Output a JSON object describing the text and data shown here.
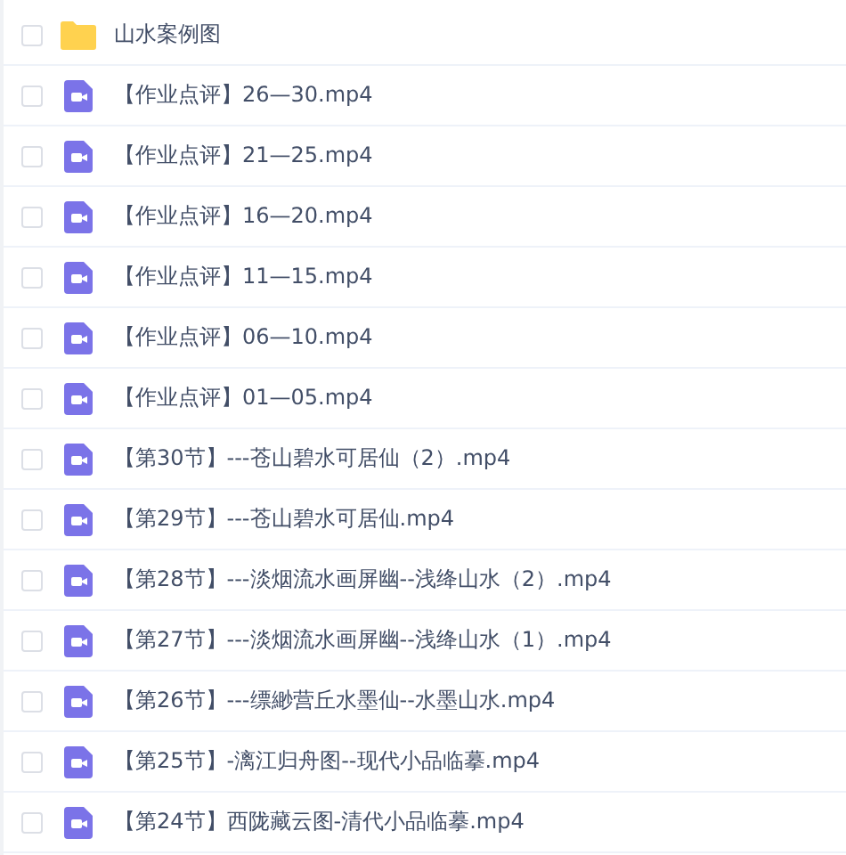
{
  "files": [
    {
      "kind": "folder",
      "name": "山水案例图",
      "checked": false
    },
    {
      "kind": "video",
      "name": "【作业点评】26—30.mp4",
      "checked": false
    },
    {
      "kind": "video",
      "name": "【作业点评】21—25.mp4",
      "checked": false
    },
    {
      "kind": "video",
      "name": "【作业点评】16—20.mp4",
      "checked": false
    },
    {
      "kind": "video",
      "name": "【作业点评】11—15.mp4",
      "checked": false
    },
    {
      "kind": "video",
      "name": "【作业点评】06—10.mp4",
      "checked": false
    },
    {
      "kind": "video",
      "name": "【作业点评】01—05.mp4",
      "checked": false
    },
    {
      "kind": "video",
      "name": "【第30节】---苍山碧水可居仙（2）.mp4",
      "checked": false
    },
    {
      "kind": "video",
      "name": "【第29节】---苍山碧水可居仙.mp4",
      "checked": false
    },
    {
      "kind": "video",
      "name": "【第28节】---淡烟流水画屏幽--浅绛山水（2）.mp4",
      "checked": false
    },
    {
      "kind": "video",
      "name": "【第27节】---淡烟流水画屏幽--浅绛山水（1）.mp4",
      "checked": false
    },
    {
      "kind": "video",
      "name": "【第26节】---缥緲营丘水墨仙--水墨山水.mp4",
      "checked": false
    },
    {
      "kind": "video",
      "name": "【第25节】-漓江归舟图--现代小品临摹.mp4",
      "checked": false
    },
    {
      "kind": "video",
      "name": "【第24节】西陇藏云图-清代小品临摹.mp4",
      "checked": false
    }
  ]
}
